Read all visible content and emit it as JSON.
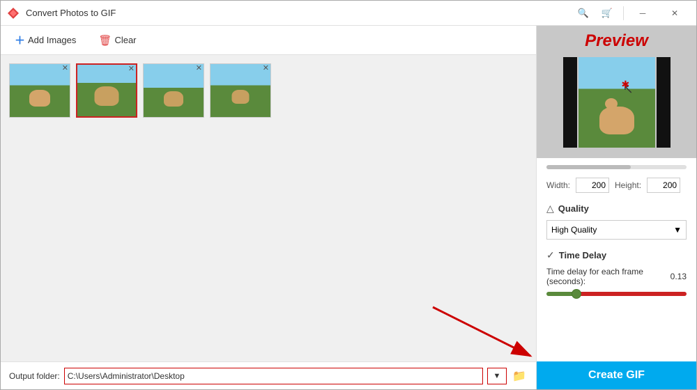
{
  "window": {
    "title": "Convert Photos to GIF",
    "logo_color": "#e04040"
  },
  "toolbar": {
    "add_label": "Add Images",
    "clear_label": "Clear"
  },
  "thumbnails": [
    {
      "id": 1,
      "selected": false,
      "label": "Dog photo 1"
    },
    {
      "id": 2,
      "selected": true,
      "label": "Dog photo 2"
    },
    {
      "id": 3,
      "selected": false,
      "label": "Dog photo 3"
    },
    {
      "id": 4,
      "selected": false,
      "label": "Dog photo 4"
    }
  ],
  "preview": {
    "label": "Preview"
  },
  "settings": {
    "width_label": "Width:",
    "height_label": "Height:",
    "width_value": "200",
    "height_value": "200",
    "quality_section_title": "Quality",
    "quality_option": "High Quality",
    "time_delay_title": "Time Delay",
    "time_delay_desc": "Time delay for each frame (seconds):",
    "time_delay_value": "0.13"
  },
  "output": {
    "label": "Output folder:",
    "path": "C:\\Users\\Administrator\\Desktop",
    "dropdown_arrow": "▼"
  },
  "create_btn": {
    "label": "Create GIF"
  }
}
